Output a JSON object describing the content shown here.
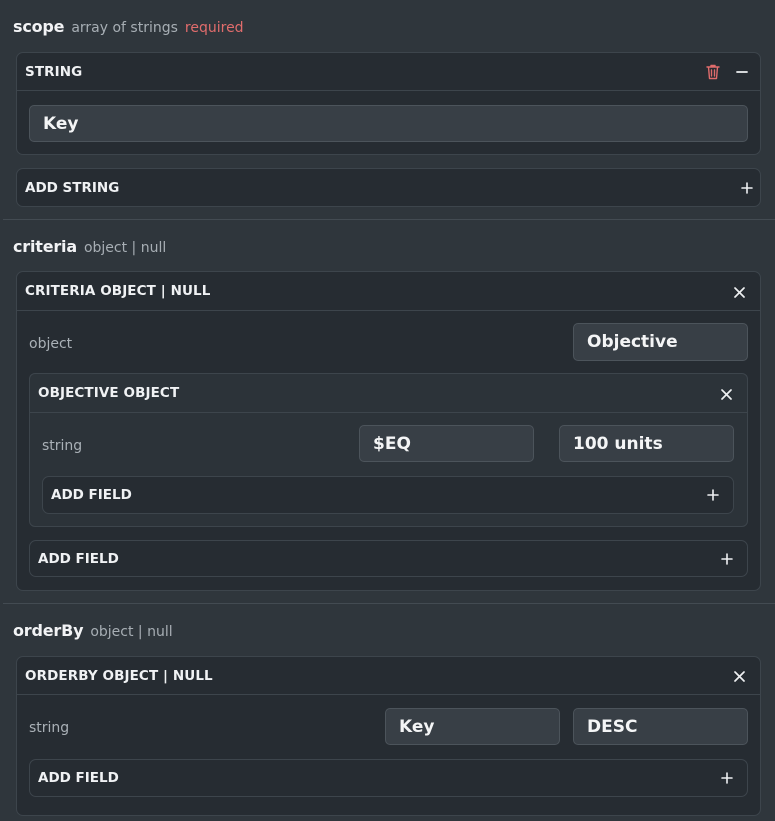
{
  "scope": {
    "name": "scope",
    "type": "array of strings",
    "required": "required",
    "item_title": "STRING",
    "item_value": "Key",
    "add_label": "ADD STRING"
  },
  "criteria": {
    "name": "criteria",
    "type": "object | null",
    "card_title": "CRITERIA OBJECT | NULL",
    "object_label": "object",
    "object_value": "Objective",
    "objective": {
      "title": "OBJECTIVE OBJECT",
      "field_label": "string",
      "operator_value": "$EQ",
      "field_value": "100 units",
      "add_label": "ADD FIELD"
    },
    "add_label": "ADD FIELD"
  },
  "orderBy": {
    "name": "orderBy",
    "type": "object | null",
    "card_title": "ORDERBY OBJECT | NULL",
    "field_label": "string",
    "key_value": "Key",
    "direction_value": "DESC",
    "add_label": "ADD FIELD"
  },
  "icons": {
    "trash": "trash-icon",
    "minus": "minus-icon",
    "close": "close-icon",
    "plus": "plus-icon"
  },
  "colors": {
    "required": "#e06c6c",
    "trash": "#e06c6c"
  }
}
